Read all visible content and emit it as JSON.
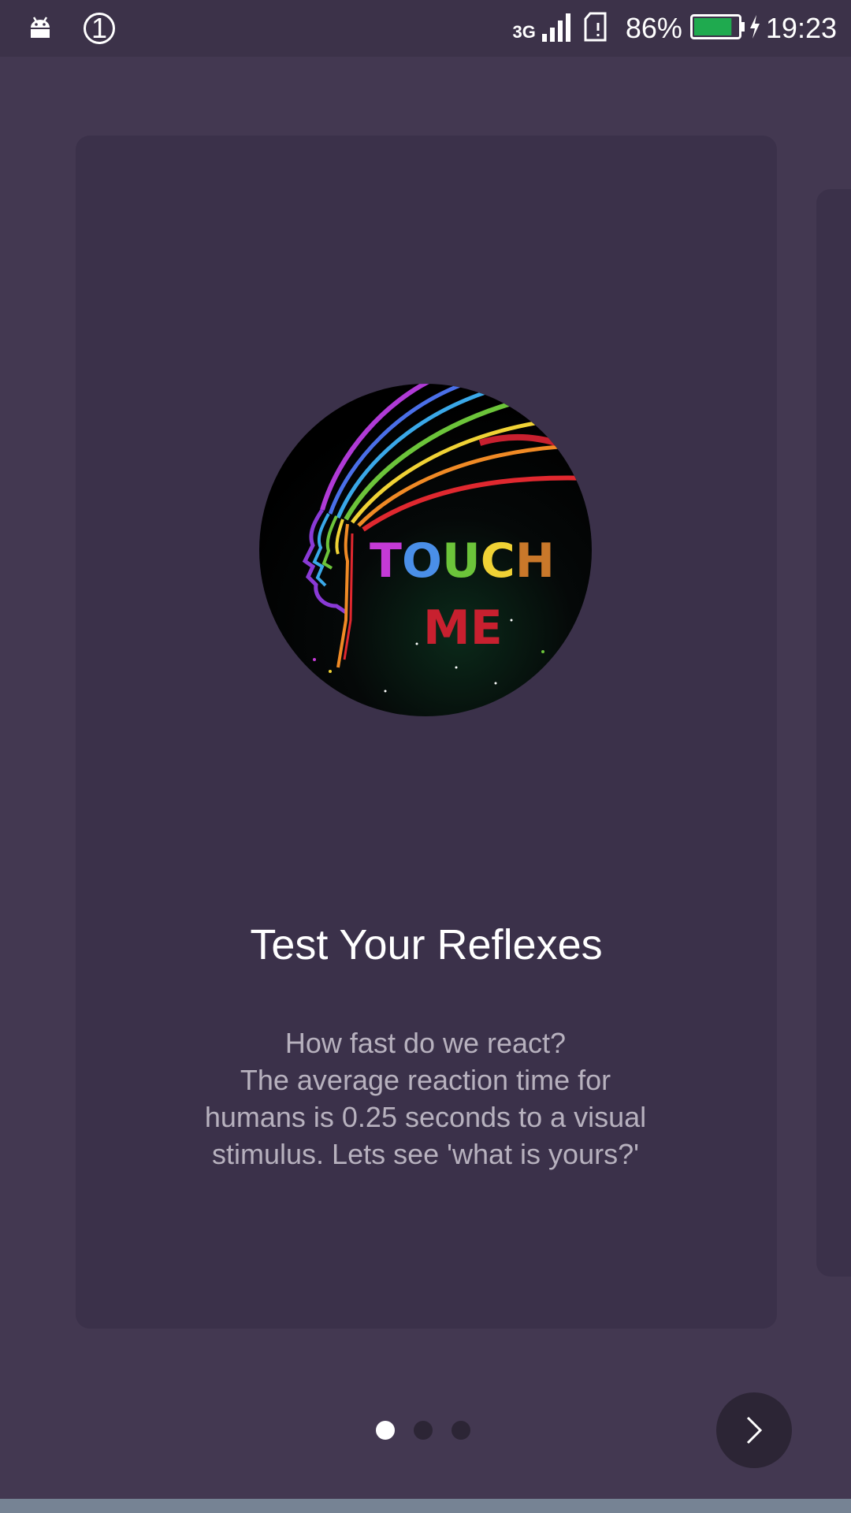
{
  "status_bar": {
    "notification_count": "1",
    "network_type": "3G",
    "battery_percent": "86%",
    "battery_level": 0.86,
    "battery_color": "#1faa4f",
    "time": "19:23",
    "icons": [
      "android-icon",
      "signal-bars-icon",
      "sim-card-icon",
      "battery-icon",
      "charging-bolt-icon"
    ]
  },
  "onboarding": {
    "hero_image": {
      "text_line1": "TOUCH",
      "text_line2": "ME",
      "letter_colors": [
        "#c43ad6",
        "#4a8fe8",
        "#6cc43a",
        "#f0d235",
        "#c9782a"
      ],
      "line2_color": "#c8202f"
    },
    "title": "Test Your Reflexes",
    "description_lines": [
      "How fast do we react?",
      "The average reaction time for",
      "humans is 0.25 seconds to a visual",
      "stimulus. Lets see 'what is yours?'"
    ],
    "page_indicator": {
      "total": 3,
      "current": 1
    },
    "next_button_icon": "chevron-right-icon"
  },
  "colors": {
    "background": "#433851",
    "card": "#3b314a",
    "status_bar": "#3c3249",
    "button": "#2c2535",
    "dot_active": "#ffffff",
    "dot_inactive": "#2c2535"
  }
}
